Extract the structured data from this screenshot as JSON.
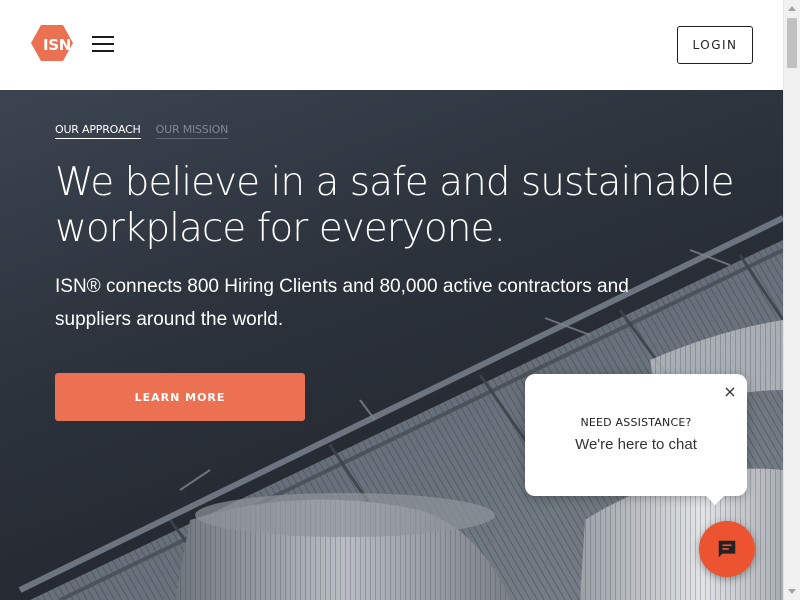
{
  "header": {
    "logo_text": "ISN",
    "login_label": "LOGIN"
  },
  "hero": {
    "tabs": [
      {
        "label": "OUR APPROACH",
        "active": true
      },
      {
        "label": "OUR MISSION",
        "active": false
      }
    ],
    "headline": "We believe in a safe and sustainable workplace for everyone.",
    "subtext": "ISN® connects 800 Hiring Clients and 80,000 active contractors and suppliers around the world.",
    "cta_label": "LEARN MORE"
  },
  "chat": {
    "close_glyph": "×",
    "title": "NEED ASSISTANCE?",
    "subtitle": "We're here to chat",
    "button_icon": "chat-bubble-icon"
  },
  "colors": {
    "brand_orange": "#ec7152",
    "chat_orange": "#ec5330",
    "hero_dark": "#2d343e"
  }
}
